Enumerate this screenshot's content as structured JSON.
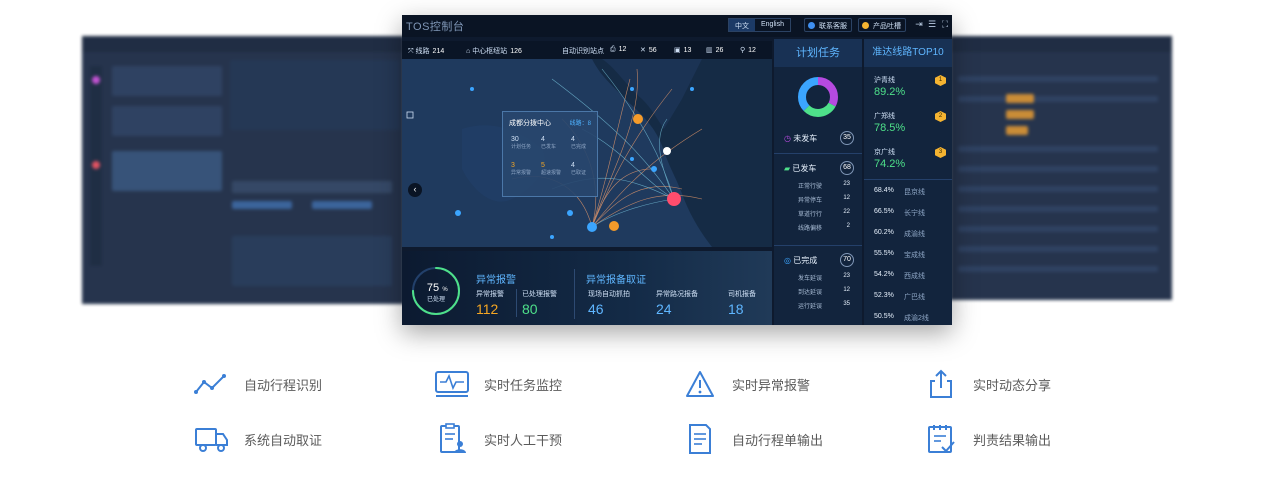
{
  "dashboard": {
    "title": "TOS控制台",
    "lang_zh": "中文",
    "lang_en": "English",
    "contact_label": "联系客服",
    "product_label": "产品吐槽",
    "status": {
      "lines_label": "线路",
      "lines_value": "214",
      "hub_label": "中心枢纽站",
      "hub_value": "126",
      "auto_label": "自动识别站点",
      "v1": "12",
      "v2": "56",
      "v3": "13",
      "v4": "26",
      "v5": "12"
    },
    "popup": {
      "title": "成都分拨中心",
      "lines": "线路：8",
      "c1n": "30",
      "c1l": "计划任务",
      "c2n": "4",
      "c2l": "已发车",
      "c3n": "4",
      "c3l": "已完成",
      "c4n": "3",
      "c4l": "异常报警",
      "c5n": "5",
      "c5l": "超速报警",
      "c6n": "4",
      "c6l": "已取证"
    },
    "alarm": {
      "gauge_value": "75",
      "gauge_unit": "%",
      "gauge_label": "已处理",
      "progress": 0.75,
      "section1": "异常报警",
      "l1": "异常报警",
      "n1": "112",
      "l2": "已处理报警",
      "n2": "80",
      "section2": "异常报备取证",
      "l3": "现场自动抓拍",
      "n3": "46",
      "l4": "异常路况报备",
      "n4": "24",
      "l5": "司机报备",
      "n5": "18"
    },
    "plan": {
      "title": "计划任务",
      "not_departed": "未发车",
      "not_departed_n": "35",
      "departed": "已发车",
      "departed_n": "68",
      "d1": "正常行驶",
      "d1n": "23",
      "d2": "异常停车",
      "d2n": "12",
      "d3": "草道行行",
      "d3n": "22",
      "d4": "线路偏移",
      "d4n": "2",
      "done": "已完成",
      "done_n": "70",
      "f1": "发车延误",
      "f1n": "23",
      "f2": "到达延误",
      "f2n": "12",
      "f3": "运行延误",
      "f3n": "35"
    },
    "top10": {
      "title": "准达线路TOP10",
      "r1_name": "沪青线",
      "r1_pct": "89.2%",
      "r1_rank": "1",
      "r2_name": "广郑线",
      "r2_pct": "78.5%",
      "r2_rank": "2",
      "r3_name": "京广线",
      "r3_pct": "74.2%",
      "r3_rank": "3",
      "list": [
        {
          "pct": "68.4%",
          "name": "昆京线"
        },
        {
          "pct": "66.5%",
          "name": "长宁线"
        },
        {
          "pct": "60.2%",
          "name": "成渝线"
        },
        {
          "pct": "55.5%",
          "name": "宝成线"
        },
        {
          "pct": "54.2%",
          "name": "西成线"
        },
        {
          "pct": "52.3%",
          "name": "广巴线"
        },
        {
          "pct": "50.5%",
          "name": "成渝2线"
        }
      ]
    }
  },
  "features": [
    {
      "label": "自动行程识别",
      "icon": "route-line-icon"
    },
    {
      "label": "实时任务监控",
      "icon": "monitor-pulse-icon"
    },
    {
      "label": "实时异常报警",
      "icon": "warning-triangle-icon"
    },
    {
      "label": "实时动态分享",
      "icon": "share-upload-icon"
    },
    {
      "label": "系统自动取证",
      "icon": "truck-icon"
    },
    {
      "label": "实时人工干预",
      "icon": "clipboard-user-icon"
    },
    {
      "label": "自动行程单输出",
      "icon": "document-lines-icon"
    },
    {
      "label": "判责结果输出",
      "icon": "checklist-icon"
    }
  ],
  "colors": {
    "accent_blue": "#5fb6ff",
    "feature_icon": "#3b7fd6",
    "green": "#4ee08a",
    "orange": "#f5a623"
  }
}
